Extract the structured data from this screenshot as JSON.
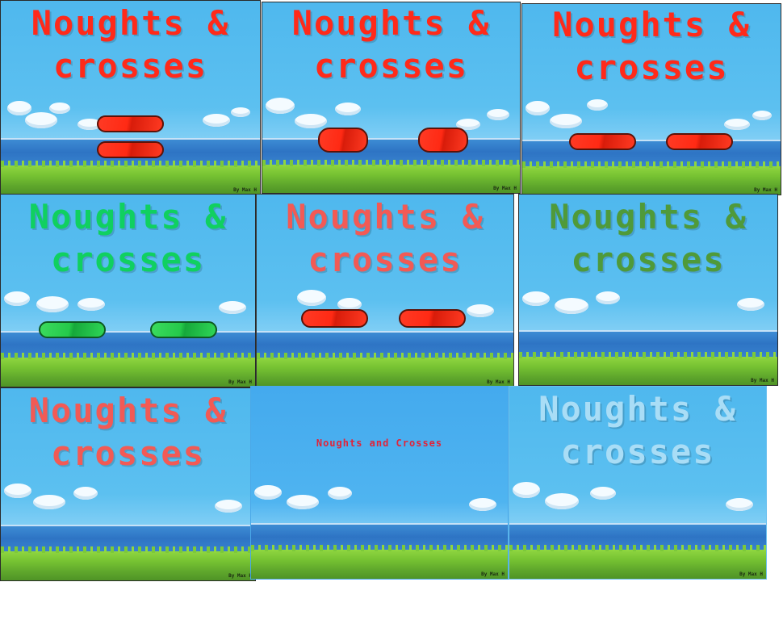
{
  "colors": {
    "title_red": "#ff2a1a",
    "title_green": "#10d060",
    "title_salmon": "#f25a55",
    "title_olive": "#4f9a3a",
    "title_pale": "#a9ddf6",
    "subtitle_red": "#e0243a"
  },
  "panels": [
    {
      "title_line1": "Noughts &",
      "title_line2": "crosses",
      "credit": "By Max H"
    },
    {
      "title_line1": "Noughts &",
      "title_line2": "crosses",
      "credit": "By Max H"
    },
    {
      "title_line1": "Noughts &",
      "title_line2": "crosses",
      "credit": "By Max H"
    },
    {
      "title_line1": "Noughts &",
      "title_line2": "crosses",
      "credit": "By Max H"
    },
    {
      "title_line1": "Noughts &",
      "title_line2": "crosses",
      "credit": "By Max H"
    },
    {
      "title_line1": "Noughts &",
      "title_line2": "crosses",
      "credit": "By Max H"
    },
    {
      "title_line1": "Noughts &",
      "title_line2": "crosses",
      "credit": "By Max H"
    },
    {
      "title": "Noughts and Crosses",
      "credit": "By Max H"
    },
    {
      "title_line1": "Noughts &",
      "title_line2": "crosses",
      "credit": "By Max H"
    }
  ],
  "icons": [
    "cloud-icon"
  ]
}
